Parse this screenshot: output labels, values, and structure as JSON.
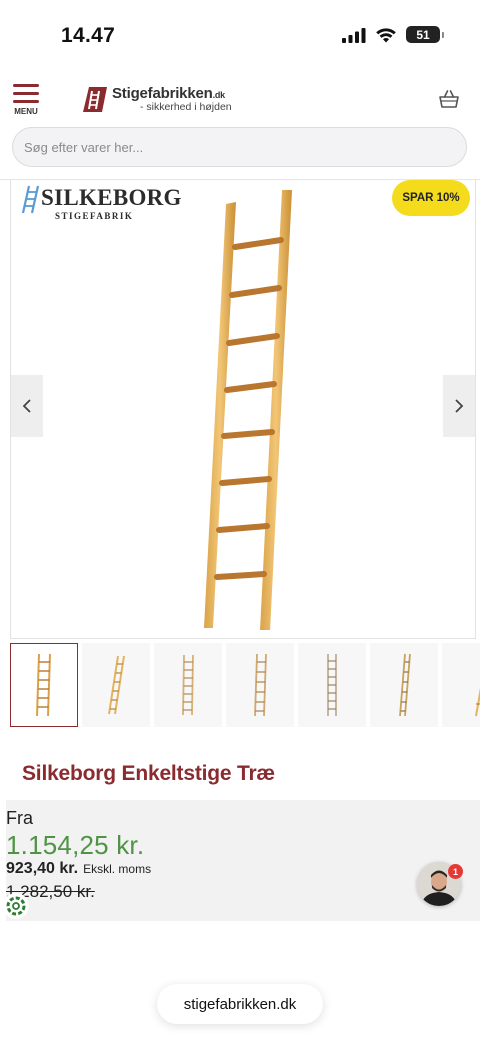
{
  "status_bar": {
    "time": "14.47",
    "battery": "51",
    "icons": [
      "cellular-signal-icon",
      "wifi-icon",
      "battery-icon"
    ]
  },
  "header": {
    "menu_label": "MENU",
    "logo_name": "Stigefabrikken",
    "logo_domain": ".dk",
    "logo_tagline": "- sikkerhed i højden",
    "basket_icon": "basket-icon"
  },
  "search": {
    "placeholder": "Søg efter varer her..."
  },
  "gallery": {
    "brand_name": "SILKEBORG",
    "brand_sub": "STIGEFABRIK",
    "sale_badge": "SPAR 10%",
    "prev_icon": "chevron-left-icon",
    "next_icon": "chevron-right-icon",
    "thumbnail_count": 7,
    "active_thumbnail": 1
  },
  "product": {
    "title": "Silkeborg Enkeltstige Træ",
    "price_from_label": "Fra",
    "price": "1.154,25 kr.",
    "price_ex_vat": "923,40 kr.",
    "price_ex_vat_label": "Ekskl. moms",
    "price_old": "1.282,50 kr."
  },
  "chat": {
    "badge_count": "1"
  },
  "browser": {
    "url": "stigefabrikken.dk"
  },
  "colors": {
    "brand": "#8a2b2f",
    "price_green": "#4e9444",
    "badge_yellow": "#f4dc1c",
    "wood": "#e2ad52"
  }
}
